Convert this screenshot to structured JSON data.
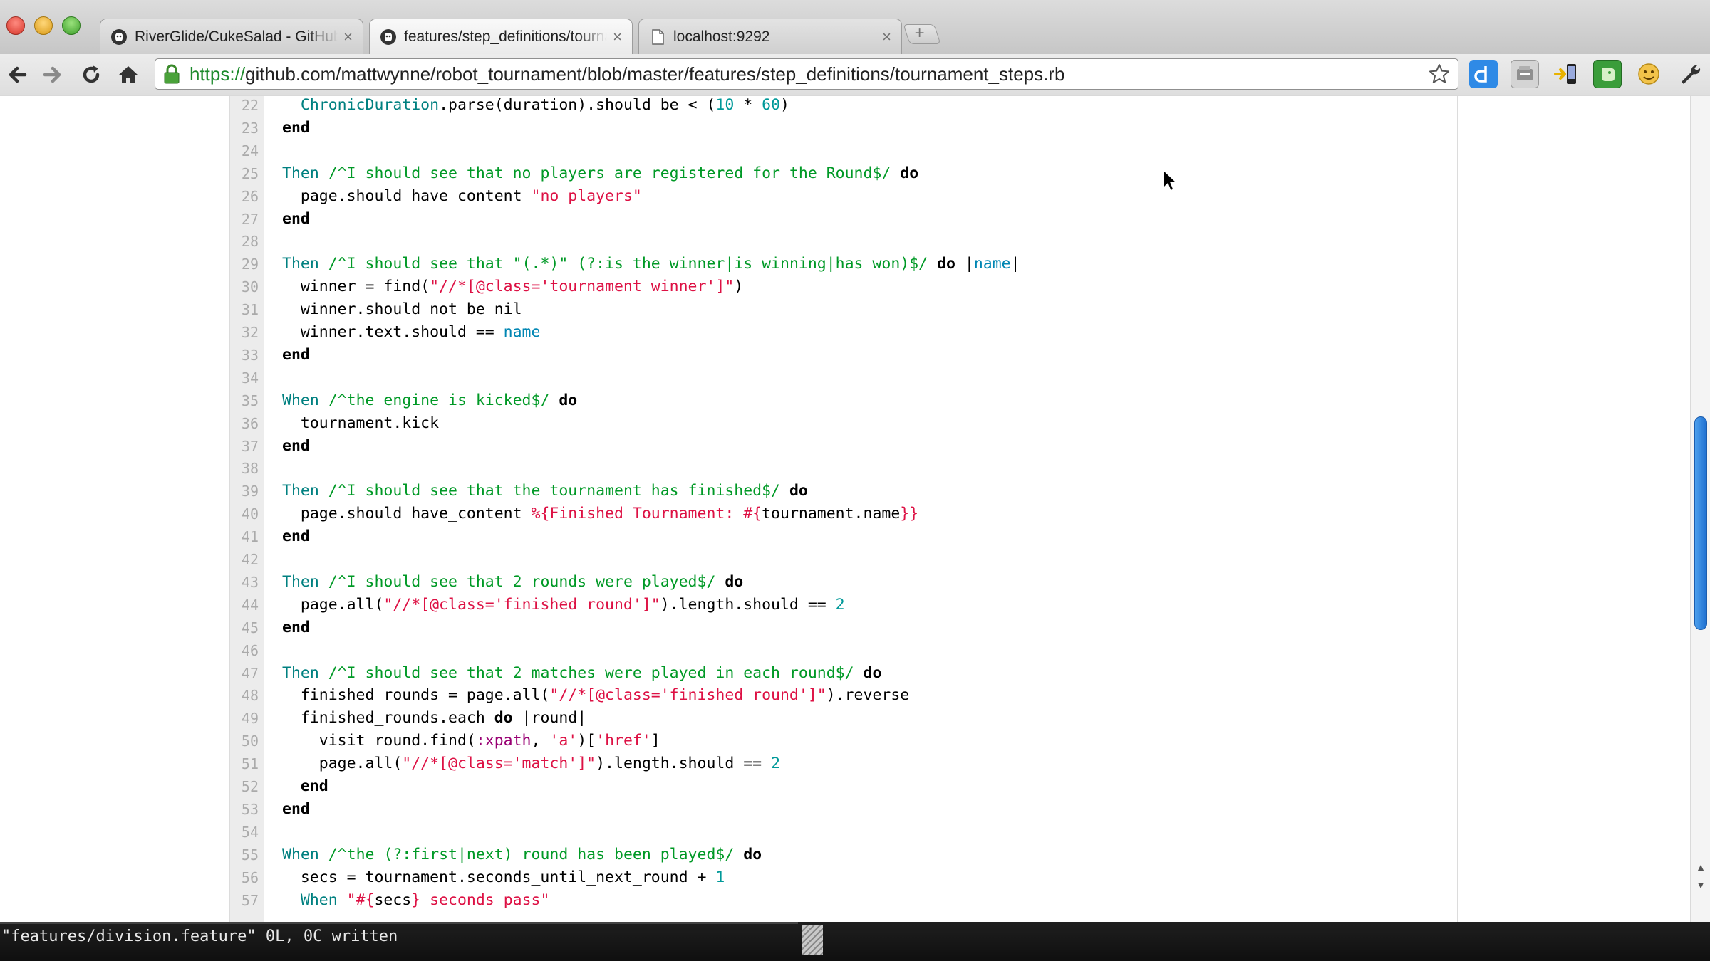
{
  "browser": {
    "tabs": [
      {
        "label": "RiverGlide/CukeSalad - GitHub",
        "icon": "github-icon",
        "active": false
      },
      {
        "label": "features/step_definitions/tournament_steps.rb",
        "icon": "github-icon",
        "active": true
      },
      {
        "label": "localhost:9292",
        "icon": "page-icon",
        "active": false
      }
    ],
    "close_glyph": "×",
    "new_tab_glyph": "+",
    "url_scheme": "https://",
    "url_rest": "github.com/mattwynne/robot_tournament/blob/master/features/step_definitions/tournament_steps.rb"
  },
  "code": {
    "lines": [
      {
        "n": "22",
        "html": "  <span class=\"tok-const\">ChronicDuration</span>.parse(duration).should be &lt; (<span class=\"tok-num\">10</span> * <span class=\"tok-num\">60</span>)"
      },
      {
        "n": "23",
        "html": "<span class=\"tok-kw\">end</span>"
      },
      {
        "n": "24",
        "html": ""
      },
      {
        "n": "25",
        "html": "<span class=\"tok-const\">Then</span> <span class=\"tok-re\">/^I should see that no players are registered for the Round$/</span> <span class=\"tok-kw\">do</span>"
      },
      {
        "n": "26",
        "html": "  page.should have_content <span class=\"tok-str\">\"no players\"</span>"
      },
      {
        "n": "27",
        "html": "<span class=\"tok-kw\">end</span>"
      },
      {
        "n": "28",
        "html": ""
      },
      {
        "n": "29",
        "html": "<span class=\"tok-const\">Then</span> <span class=\"tok-re\">/^I should see that \"(.*)\" (?:is the winner|is winning|has won)$/</span> <span class=\"tok-kw\">do</span> |<span class=\"tok-var\">name</span>|"
      },
      {
        "n": "30",
        "html": "  winner = find(<span class=\"tok-str\">\"//*[@class='tournament winner']\"</span>)"
      },
      {
        "n": "31",
        "html": "  winner.should_not be_nil"
      },
      {
        "n": "32",
        "html": "  winner.text.should == <span class=\"tok-var\">name</span>"
      },
      {
        "n": "33",
        "html": "<span class=\"tok-kw\">end</span>"
      },
      {
        "n": "34",
        "html": ""
      },
      {
        "n": "35",
        "html": "<span class=\"tok-const\">When</span> <span class=\"tok-re\">/^the engine is kicked$/</span> <span class=\"tok-kw\">do</span>"
      },
      {
        "n": "36",
        "html": "  tournament.kick"
      },
      {
        "n": "37",
        "html": "<span class=\"tok-kw\">end</span>"
      },
      {
        "n": "38",
        "html": ""
      },
      {
        "n": "39",
        "html": "<span class=\"tok-const\">Then</span> <span class=\"tok-re\">/^I should see that the tournament has finished$/</span> <span class=\"tok-kw\">do</span>"
      },
      {
        "n": "40",
        "html": "  page.should have_content <span class=\"tok-str\">%{Finished Tournament: #{</span>tournament.name<span class=\"tok-str\">}}</span>"
      },
      {
        "n": "41",
        "html": "<span class=\"tok-kw\">end</span>"
      },
      {
        "n": "42",
        "html": ""
      },
      {
        "n": "43",
        "html": "<span class=\"tok-const\">Then</span> <span class=\"tok-re\">/^I should see that 2 rounds were played$/</span> <span class=\"tok-kw\">do</span>"
      },
      {
        "n": "44",
        "html": "  page.all(<span class=\"tok-str\">\"//*[@class='finished round']\"</span>).length.should == <span class=\"tok-num\">2</span>"
      },
      {
        "n": "45",
        "html": "<span class=\"tok-kw\">end</span>"
      },
      {
        "n": "46",
        "html": ""
      },
      {
        "n": "47",
        "html": "<span class=\"tok-const\">Then</span> <span class=\"tok-re\">/^I should see that 2 matches were played in each round$/</span> <span class=\"tok-kw\">do</span>"
      },
      {
        "n": "48",
        "html": "  finished_rounds = page.all(<span class=\"tok-str\">\"//*[@class='finished round']\"</span>).reverse"
      },
      {
        "n": "49",
        "html": "  finished_rounds.each <span class=\"tok-kw\">do</span> |round|"
      },
      {
        "n": "50",
        "html": "    visit round.find(<span class=\"tok-sym\">:xpath</span>, <span class=\"tok-str\">'a'</span>)[<span class=\"tok-str\">'href'</span>]"
      },
      {
        "n": "51",
        "html": "    page.all(<span class=\"tok-str\">\"//*[@class='match']\"</span>).length.should == <span class=\"tok-num\">2</span>"
      },
      {
        "n": "52",
        "html": "  <span class=\"tok-kw\">end</span>"
      },
      {
        "n": "53",
        "html": "<span class=\"tok-kw\">end</span>"
      },
      {
        "n": "54",
        "html": ""
      },
      {
        "n": "55",
        "html": "<span class=\"tok-const\">When</span> <span class=\"tok-re\">/^the (?:first|next) round has been played$/</span> <span class=\"tok-kw\">do</span>"
      },
      {
        "n": "56",
        "html": "  secs = tournament.seconds_until_next_round + <span class=\"tok-num\">1</span>"
      },
      {
        "n": "57",
        "html": "  <span class=\"tok-const\">When</span> <span class=\"tok-str\">\"#{</span>secs<span class=\"tok-str\">} seconds pass\"</span>"
      }
    ]
  },
  "terminal": {
    "status": "\"features/division.feature\" 0L, 0C written"
  },
  "colors": {
    "accent_scroll": "#2f80dd",
    "regex": "#009926",
    "string": "#dd1144",
    "number": "#009999"
  }
}
